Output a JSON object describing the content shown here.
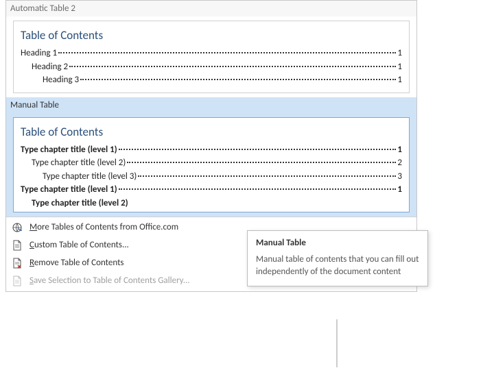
{
  "gallery": {
    "auto2": {
      "header": "Automatic Table 2",
      "title": "Table of Contents",
      "rows": [
        {
          "label": "Heading 1",
          "page": "1",
          "indent": 0,
          "bold": false
        },
        {
          "label": "Heading 2",
          "page": "1",
          "indent": 1,
          "bold": false
        },
        {
          "label": "Heading 3",
          "page": "1",
          "indent": 2,
          "bold": false
        }
      ]
    },
    "manual": {
      "header": "Manual Table",
      "title": "Table of Contents",
      "rows": [
        {
          "label": "Type chapter title (level 1)",
          "page": "1",
          "indent": 0,
          "bold": true
        },
        {
          "label": "Type chapter title (level 2)",
          "page": "2",
          "indent": 1,
          "bold": false
        },
        {
          "label": "Type chapter title (level 3)",
          "page": "3",
          "indent": 2,
          "bold": false
        },
        {
          "label": "Type chapter title (level 1)",
          "page": "1",
          "indent": 0,
          "bold": true
        }
      ],
      "cutoff_label": "Type chapter title (level 2)"
    }
  },
  "menu": {
    "more": "More Tables of Contents from Office.com",
    "custom": "Custom Table of Contents...",
    "remove": "Remove Table of Contents",
    "save": "Save Selection to Table of Contents Gallery..."
  },
  "tooltip": {
    "title": "Manual Table",
    "body": "Manual table of contents that you can fill out independently of the document content"
  }
}
